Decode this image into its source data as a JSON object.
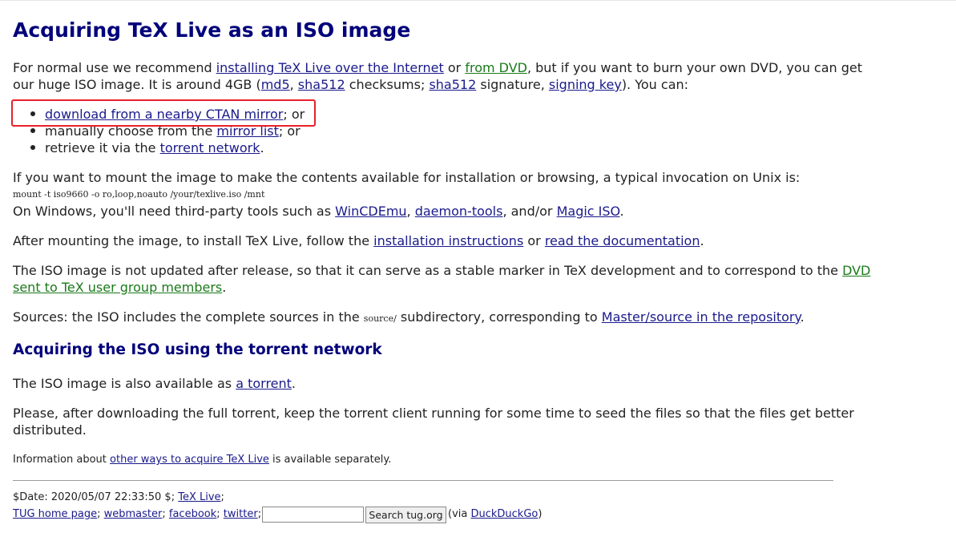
{
  "title": "Acquiring TeX Live as an ISO image",
  "intro": {
    "t1": "For normal use we recommend ",
    "link_internet": "installing TeX Live over the Internet",
    "t2": " or ",
    "link_dvd": "from DVD",
    "t3": ", but if you want to burn your own DVD, you can get",
    "t4": "our huge ISO image. It is around 4GB (",
    "link_md5": "md5",
    "t5": ", ",
    "link_sha512": "sha512",
    "t6": " checksums; ",
    "link_sha512_sig": "sha512",
    "t7": " signature, ",
    "link_signing_key": "signing key",
    "t8": "). You can:"
  },
  "list": {
    "item1_link": "download from a nearby CTAN mirror",
    "item1_suffix": "; or",
    "item2_prefix": "manually choose from the ",
    "item2_link": "mirror list",
    "item2_suffix": "; or",
    "item3_prefix": "retrieve it via the ",
    "item3_link": "torrent network",
    "item3_suffix": "."
  },
  "mount": {
    "text": "If you want to mount the image to make the contents available for installation or browsing, a typical invocation on Unix is:",
    "command": "mount -t iso9660 -o ro,loop,noauto /your/texlive.iso /mnt",
    "win_prefix": "On Windows, you'll need third-party tools such as ",
    "link_wincdemu": "WinCDEmu",
    "sep1": ", ",
    "link_daemon": "daemon-tools",
    "sep2": ", and/or ",
    "link_magiciso": "Magic ISO",
    "win_suffix": "."
  },
  "after_mount": {
    "prefix": "After mounting the image, to install TeX Live, follow the ",
    "link_install": "installation instructions",
    "mid": " or ",
    "link_docs": "read the documentation",
    "suffix": "."
  },
  "not_updated": {
    "line1": "The ISO image is not updated after release, so that it can serve as a stable marker in TeX development and to correspond to the ",
    "link_dvd": "DVD",
    "link_dvd2": "sent to TeX user group members",
    "suffix": "."
  },
  "sources": {
    "prefix": "Sources: the ISO includes the complete sources in the ",
    "code": "source/",
    "mid": " subdirectory, corresponding to ",
    "link_repo": "Master/source in the repository",
    "suffix": "."
  },
  "torrent_heading": "Acquiring the ISO using the torrent network",
  "torrent_avail": {
    "prefix": "The ISO image is also available as ",
    "link": "a torrent",
    "suffix": "."
  },
  "please": {
    "line1": "Please, after downloading the full torrent, keep the torrent client running for some time to seed the files so that the files get better",
    "line2": "distributed."
  },
  "info": {
    "prefix": "Information about ",
    "link": "other ways to acquire TeX Live",
    "suffix": " is available separately."
  },
  "footer": {
    "date": "$Date: 2020/05/07 22:33:50 $; ",
    "link_texlive": "TeX Live",
    "date_suffix": ";",
    "link_tug": "TUG home page",
    "sep": "; ",
    "link_webmaster": "webmaster",
    "link_facebook": "facebook",
    "link_twitter": "twitter",
    "end_sep": ";",
    "search_value": "",
    "search_button": "Search tug.org",
    "via_prefix": " (via ",
    "link_ddg": "DuckDuckGo",
    "via_suffix": ")"
  },
  "colors": {
    "heading": "#00007a",
    "link_blue": "#1a1a8c",
    "link_green": "#1a7a1a",
    "highlight": "#e8202a"
  }
}
